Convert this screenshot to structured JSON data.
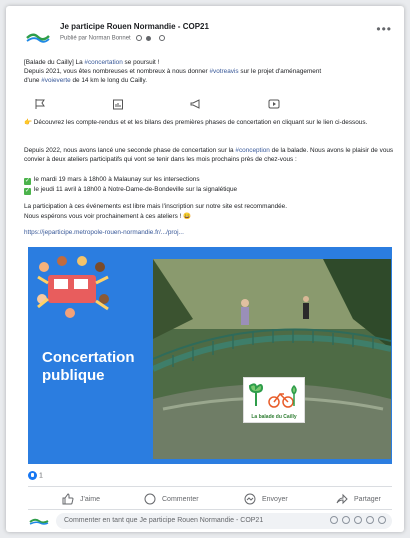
{
  "header": {
    "page_name": "Je participe Rouen Normandie - COP21",
    "published_by": "Publié par Norman Bonnet",
    "more_label": "•••"
  },
  "post": {
    "line1_prefix": "[Balade du Cailly] La ",
    "line1_hashtag": "#concertation",
    "line1_suffix": " se poursuit !",
    "line2_prefix": "Depuis 2021, vous êtes nombreuses et nombreux à nous donner ",
    "line2_hashtag": "#votreavis",
    "line2_suffix": " sur le projet d'aménagement",
    "line3_prefix": "d'une ",
    "line3_hashtag": "#voieverte",
    "line3_suffix": " de 14 km le long du Cailly.",
    "paragraph_compte": "👉 Découvrez les compte-rendus et et les bilans des premières phases de concertation en cliquant sur le lien ci-dessous.",
    "phase_prefix": "Depuis 2022, nous avons lancé une seconde phase de concertation sur la ",
    "phase_hashtag": "#conception",
    "phase_suffix": " de la balade. Nous avons le plaisir de vous convier à deux ateliers participatifs qui vont se tenir dans les mois prochains près de chez-vous :",
    "item1": "le mardi 19 mars à 18h00 à Malaunay sur les intersections",
    "item2": "le jeudi 11 avril à 18h00 à Notre-Dame-de-Bondeville sur la signalétique",
    "closing1": "La participation à ces événements est libre mais l'inscription sur notre site est recommandée.",
    "closing2": "Nous espérons vous voir prochainement à ces ateliers ! 😀",
    "link": "https://jeparticipe.metropole-rouen-normandie.fr/.../proj..."
  },
  "image": {
    "title_line1": "Concertation",
    "title_line2": "publique",
    "logo_caption": "La balade du Cailly"
  },
  "reactions": {
    "count": "1"
  },
  "actions": {
    "like": "J'aime",
    "comment": "Commenter",
    "send": "Envoyer",
    "share": "Partager"
  },
  "comment_box": {
    "placeholder": "Commenter en tant que Je participe Rouen Normandie - COP21"
  },
  "colors": {
    "accent": "#1877f2",
    "hashtag": "#385898",
    "image_bg": "#2b7de0"
  }
}
